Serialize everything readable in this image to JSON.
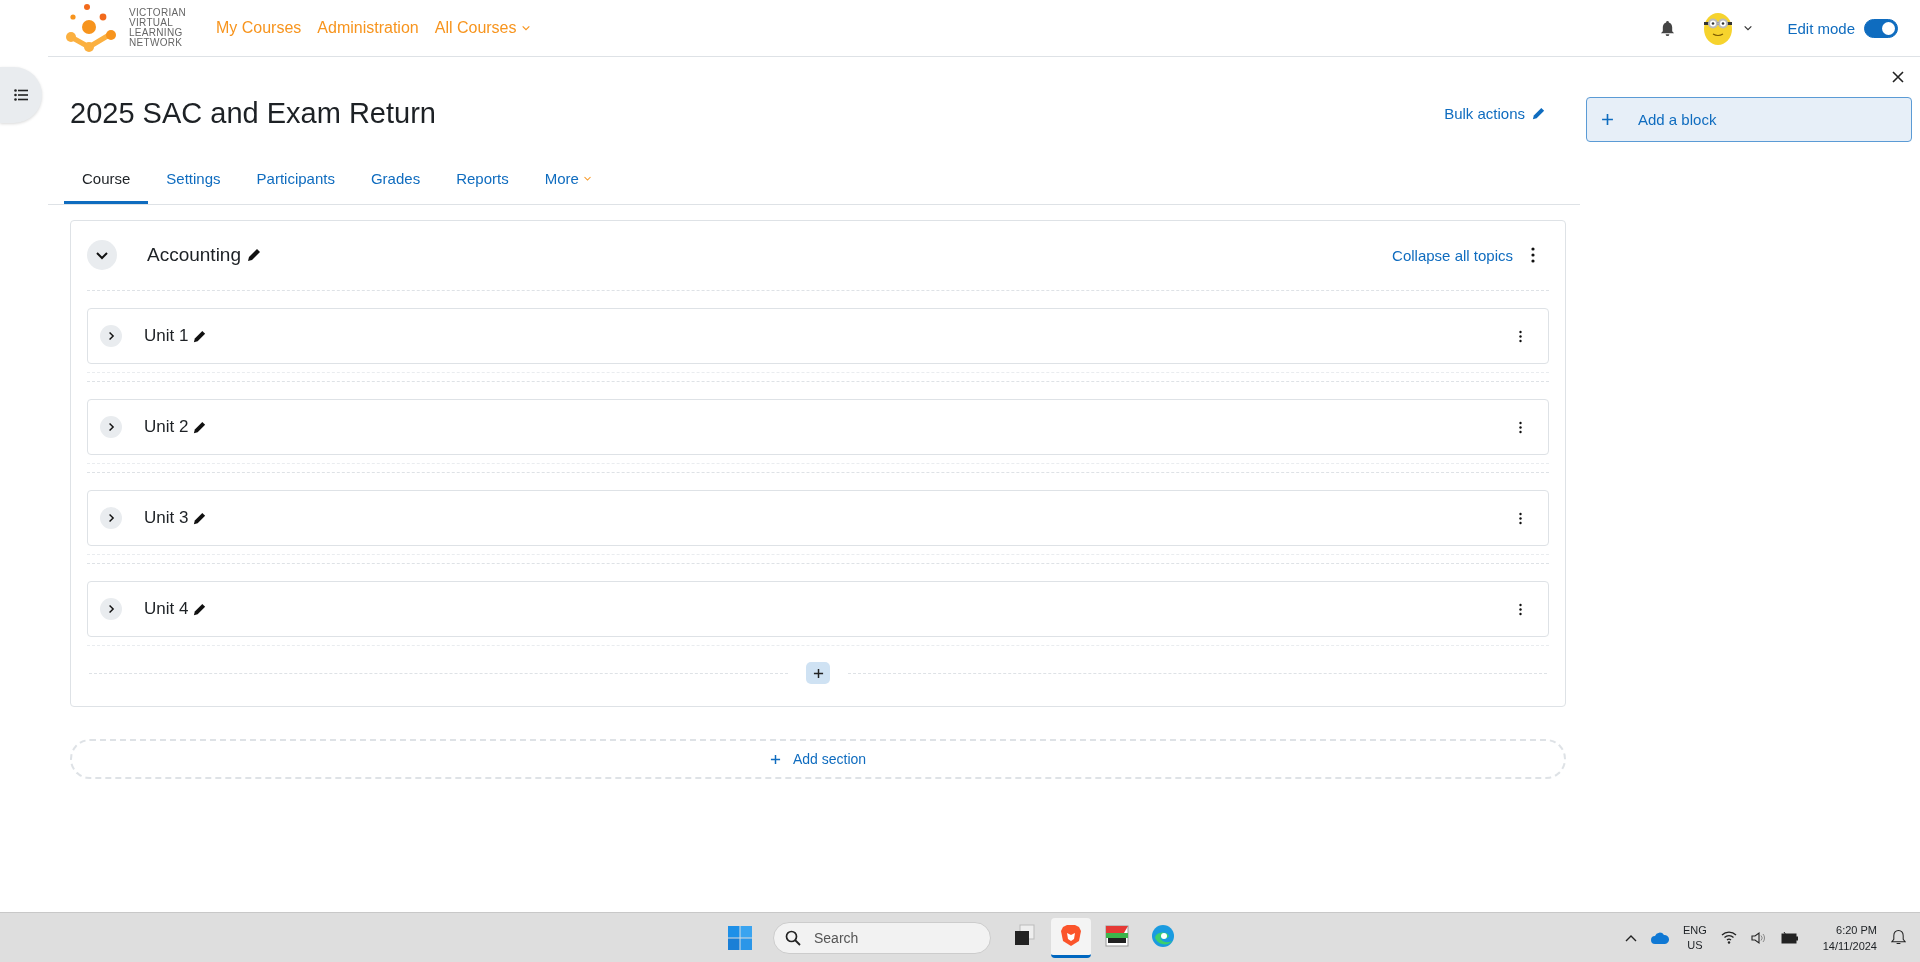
{
  "header": {
    "logo_text": "VICTORIAN\nVIRTUAL\nLEARNING\nNETWORK",
    "nav": [
      {
        "label": "My Courses",
        "dropdown": false
      },
      {
        "label": "Administration",
        "dropdown": false
      },
      {
        "label": "All Courses",
        "dropdown": true
      }
    ],
    "edit_mode": {
      "label": "Edit mode",
      "on": true
    }
  },
  "course": {
    "title": "2025 SAC and Exam Return",
    "bulk_actions": "Bulk actions",
    "tabs": [
      {
        "label": "Course",
        "selected": true,
        "dropdown": false
      },
      {
        "label": "Settings",
        "selected": false,
        "dropdown": false
      },
      {
        "label": "Participants",
        "selected": false,
        "dropdown": false
      },
      {
        "label": "Grades",
        "selected": false,
        "dropdown": false
      },
      {
        "label": "Reports",
        "selected": false,
        "dropdown": false
      },
      {
        "label": "More",
        "selected": false,
        "dropdown": true
      }
    ]
  },
  "section": {
    "title": "Accounting",
    "expanded": true,
    "collapse_all": "Collapse all topics",
    "subsections": [
      {
        "title": "Unit 1",
        "expanded": false
      },
      {
        "title": "Unit 2",
        "expanded": false
      },
      {
        "title": "Unit 3",
        "expanded": false
      },
      {
        "title": "Unit 4",
        "expanded": false
      }
    ]
  },
  "add_section": "Add section",
  "block_drawer": {
    "add_block": "Add a block"
  },
  "taskbar": {
    "search_placeholder": "Search",
    "apps": [
      {
        "kind": "taskview",
        "selected": false
      },
      {
        "kind": "brave",
        "selected": true
      },
      {
        "kind": "terminal",
        "selected": false
      },
      {
        "kind": "edge",
        "selected": false
      }
    ],
    "language": "ENG\nUS",
    "time": "6:20 PM",
    "date": "14/11/2024"
  }
}
